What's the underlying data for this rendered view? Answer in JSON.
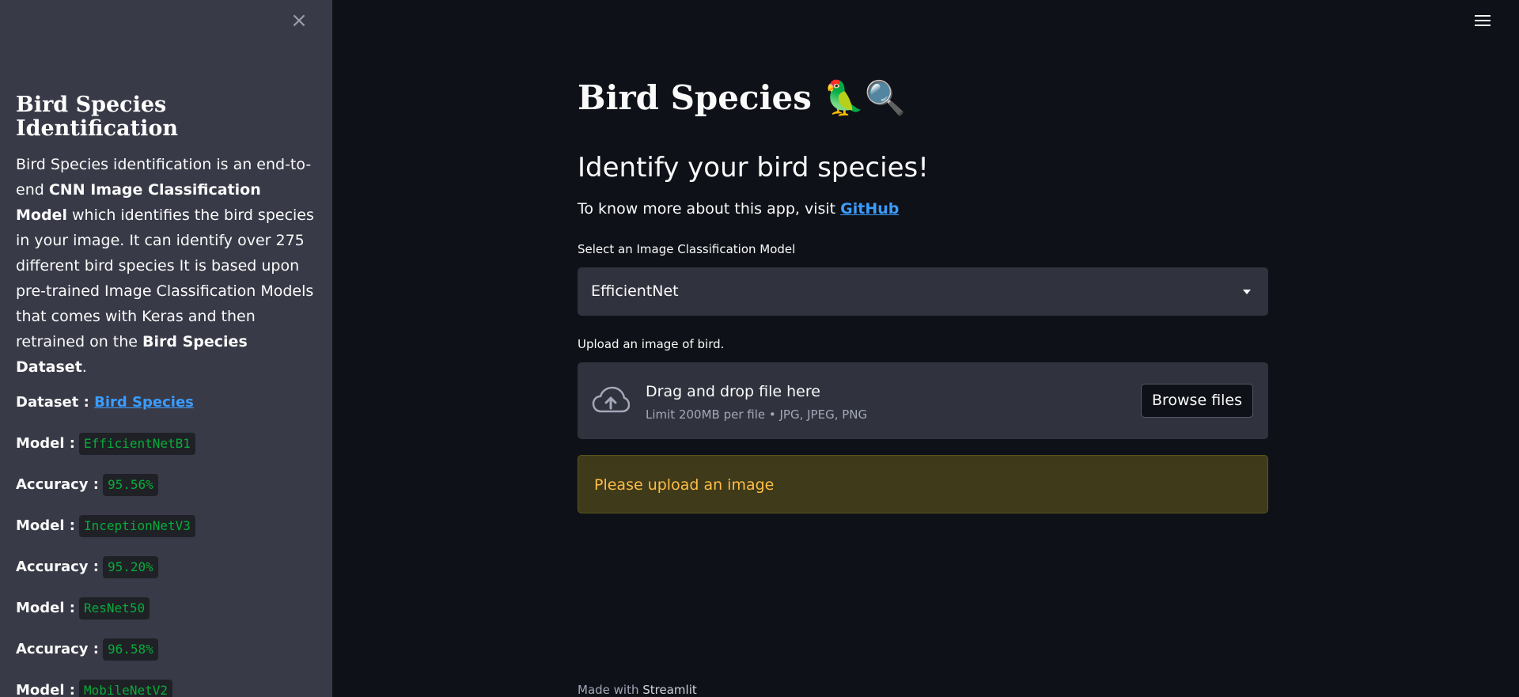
{
  "sidebar": {
    "close_icon": "×",
    "title": "Bird Species Identification",
    "desc_1": "Bird Species identification is an end-to-end ",
    "desc_bold_1": "CNN Image Classification Model",
    "desc_2": " which identifies the bird species in your image. It can identify over 275 different bird species It is based upon pre-trained Image Classification Models that comes with Keras and then retrained on the ",
    "desc_bold_2": "Bird Species Dataset",
    "desc_3": ".",
    "dataset_label": "Dataset : ",
    "dataset_link": "Bird Species",
    "rows": [
      {
        "label": "Model : ",
        "value": "EfficientNetB1"
      },
      {
        "label": "Accuracy : ",
        "value": "95.56%"
      },
      {
        "label": "Model : ",
        "value": "InceptionNetV3"
      },
      {
        "label": "Accuracy : ",
        "value": "95.20%"
      },
      {
        "label": "Model : ",
        "value": "ResNet50"
      },
      {
        "label": "Accuracy : ",
        "value": "96.58%"
      },
      {
        "label": "Model : ",
        "value": "MobileNetV2"
      }
    ]
  },
  "main": {
    "title": "Bird Species 🦜🔍",
    "subheader": "Identify your bird species!",
    "info_text": "To know more about this app, visit ",
    "info_link": "GitHub",
    "select_label": "Select an Image Classification Model",
    "select_value": "EfficientNet",
    "upload_label": "Upload an image of bird.",
    "upload_main": "Drag and drop file here",
    "upload_sub": "Limit 200MB per file • JPG, JPEG, PNG",
    "browse_label": "Browse files",
    "warning": "Please upload an image",
    "footer_text": "Made with ",
    "footer_brand": "Streamlit"
  },
  "colors": {
    "background": "#0e1117",
    "sidebar": "#383a47",
    "link": "#3b9cff",
    "code": "#09ab3b",
    "warning_text": "#ffbd45"
  },
  "icons": {
    "close": "close-icon",
    "menu": "hamburger-menu-icon",
    "upload": "cloud-upload-icon",
    "dropdown": "chevron-down-icon"
  }
}
